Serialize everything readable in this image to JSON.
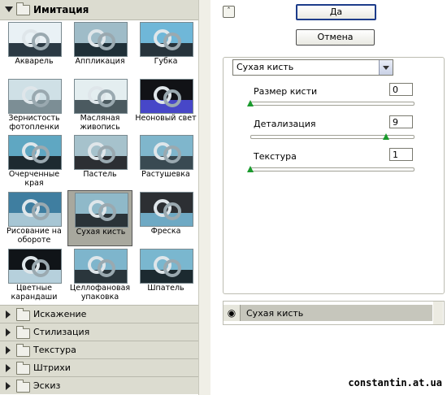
{
  "gallery": {
    "category_open": "Имитация",
    "filters": [
      "Акварель",
      "Аппликация",
      "Губка",
      "Зернистость фотопленки",
      "Масляная живопись",
      "Неоновый свет",
      "Очерченные края",
      "Пастель",
      "Растушевка",
      "Рисование на обороте",
      "Сухая кисть",
      "Фреска",
      "Цветные карандаши",
      "Целлофановая упаковка",
      "Шпатель"
    ],
    "selected": "Сухая кисть",
    "categories_closed": [
      "Искажение",
      "Стилизация",
      "Текстура",
      "Штрихи",
      "Эскиз"
    ]
  },
  "buttons": {
    "ok": "Да",
    "cancel": "Отмена"
  },
  "options": {
    "filter": "Сухая кисть",
    "params": [
      {
        "label": "Размер кисти",
        "value": "0"
      },
      {
        "label": "Детализация",
        "value": "9"
      },
      {
        "label": "Текстура",
        "value": "1"
      }
    ],
    "levels": {
      "brush_size": 0,
      "detail": 9,
      "texture": 1
    },
    "ranges": {
      "brush_size": [
        0,
        10
      ],
      "detail": [
        0,
        10
      ],
      "texture": [
        1,
        3
      ]
    }
  },
  "layer": {
    "name": "Сухая кисть",
    "icon": "eye-icon"
  },
  "watermark": "constantin.at.ua",
  "colors": {
    "header_bg": "#dcdcd0",
    "selected_cell": "#a8a89e",
    "slider_thumb": "#1a9a2d"
  }
}
